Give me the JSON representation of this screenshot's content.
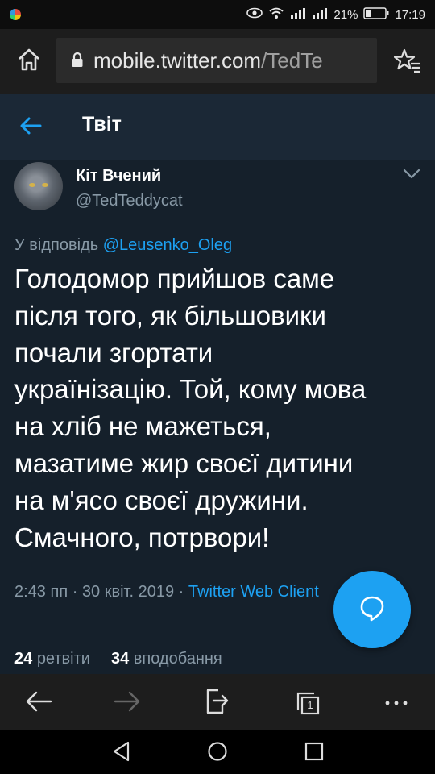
{
  "status_bar": {
    "battery_percent": "21%",
    "time": "17:19"
  },
  "browser": {
    "url_domain": "mobile.twitter.com",
    "url_path": "/TedTe"
  },
  "header": {
    "title": "Твіт"
  },
  "tweet": {
    "author_name": "Кіт Вчений",
    "author_handle": "@TedTeddycat",
    "reply_prefix": "У відповідь",
    "reply_mention": "@Leusenko_Oleg",
    "lines": [
      "Голодомор прийшов саме",
      "після того, як більшовики",
      "почали згортати",
      "українізацію. Той, кому мова",
      "на хліб не мажеться,",
      "мазатиме жир своєї дитини",
      "на м'ясо своєї дружини.",
      "Смачного, потрвори!"
    ],
    "time": "2:43 пп",
    "date": "30 квіт. 2019",
    "source": "Twitter Web Client",
    "retweets_count": "24",
    "retweets_label": "ретвіти",
    "likes_count": "34",
    "likes_label": "вподобання"
  },
  "browser_nav": {
    "tab_count": "1"
  },
  "icons": {
    "home": "home-icon",
    "lock": "lock-icon",
    "bookmark": "star-bookmark-icon",
    "back": "arrow-left-icon",
    "caret": "chevron-down-icon",
    "reply": "reply-bubble-icon"
  },
  "colors": {
    "accent": "#1da1f2",
    "background": "#15202b",
    "header_bg": "#1b2836",
    "secondary_text": "#8899a6"
  }
}
